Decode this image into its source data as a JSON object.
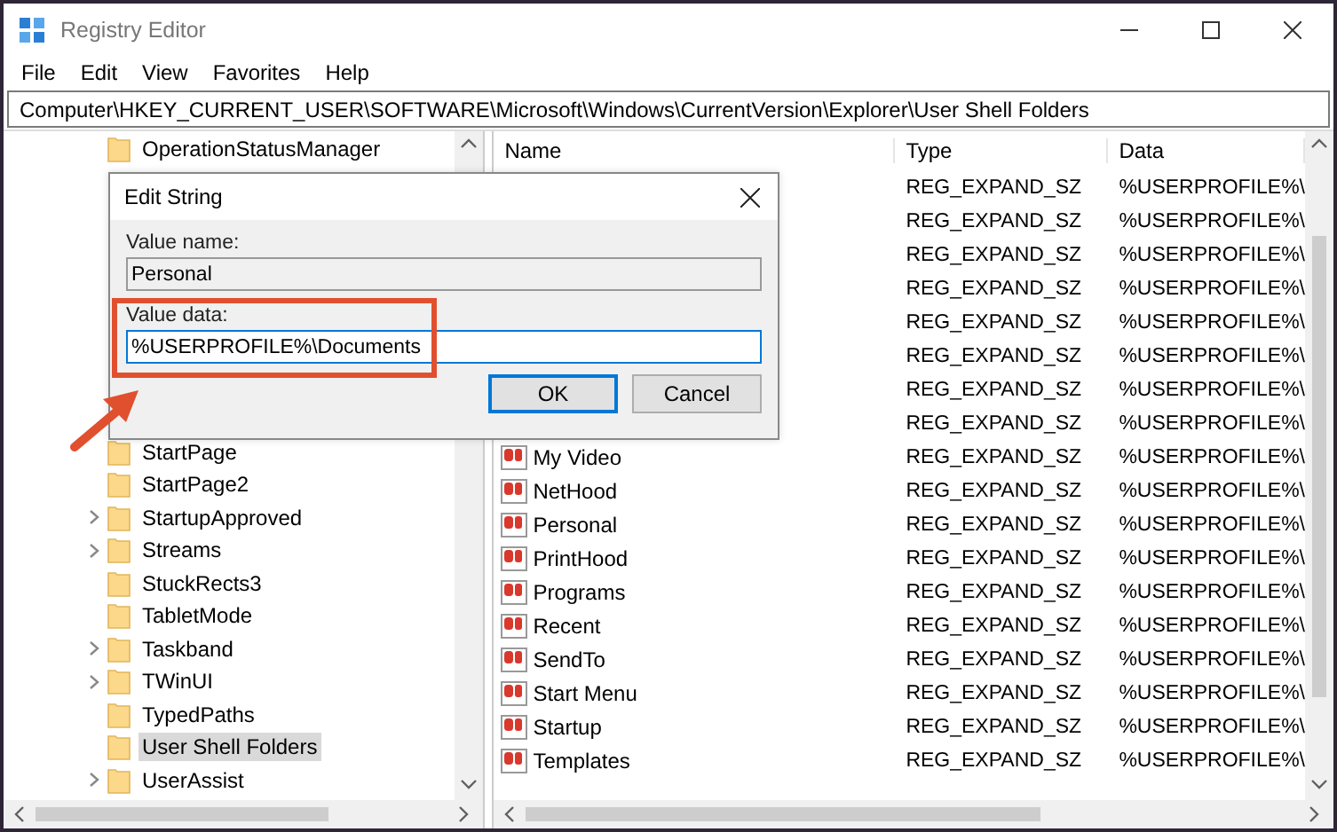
{
  "window": {
    "title": "Registry Editor"
  },
  "menu": [
    "File",
    "Edit",
    "View",
    "Favorites",
    "Help"
  ],
  "address": "Computer\\HKEY_CURRENT_USER\\SOFTWARE\\Microsoft\\Windows\\CurrentVersion\\Explorer\\User Shell Folders",
  "tree": {
    "top_items": [
      {
        "label": "OperationStatusManager",
        "expandable": false,
        "selected": false
      }
    ],
    "items": [
      {
        "label": "StartPage",
        "expandable": false,
        "selected": false
      },
      {
        "label": "StartPage2",
        "expandable": false,
        "selected": false
      },
      {
        "label": "StartupApproved",
        "expandable": true,
        "selected": false
      },
      {
        "label": "Streams",
        "expandable": true,
        "selected": false
      },
      {
        "label": "StuckRects3",
        "expandable": false,
        "selected": false
      },
      {
        "label": "TabletMode",
        "expandable": false,
        "selected": false
      },
      {
        "label": "Taskband",
        "expandable": true,
        "selected": false
      },
      {
        "label": "TWinUI",
        "expandable": true,
        "selected": false
      },
      {
        "label": "TypedPaths",
        "expandable": false,
        "selected": false
      },
      {
        "label": "User Shell Folders",
        "expandable": false,
        "selected": true
      },
      {
        "label": "UserAssist",
        "expandable": true,
        "selected": false
      }
    ]
  },
  "values": {
    "columns": [
      "Name",
      "Type",
      "Data"
    ],
    "rows": [
      {
        "type": "REG_EXPAND_SZ",
        "data": "%USERPROFILE%\\"
      },
      {
        "type": "REG_EXPAND_SZ",
        "data": "%USERPROFILE%\\"
      },
      {
        "type": "REG_EXPAND_SZ",
        "data": "%USERPROFILE%\\"
      },
      {
        "type": "REG_EXPAND_SZ",
        "data": "%USERPROFILE%\\"
      },
      {
        "type": "REG_EXPAND_SZ",
        "data": "%USERPROFILE%\\"
      },
      {
        "type": "REG_EXPAND_SZ",
        "data": "%USERPROFILE%\\"
      },
      {
        "type": "REG_EXPAND_SZ",
        "data": "%USERPROFILE%\\"
      },
      {
        "type": "REG_EXPAND_SZ",
        "data": "%USERPROFILE%\\"
      },
      {
        "name": "My Video",
        "type": "REG_EXPAND_SZ",
        "data": "%USERPROFILE%\\"
      },
      {
        "name": "NetHood",
        "type": "REG_EXPAND_SZ",
        "data": "%USERPROFILE%\\"
      },
      {
        "name": "Personal",
        "type": "REG_EXPAND_SZ",
        "data": "%USERPROFILE%\\"
      },
      {
        "name": "PrintHood",
        "type": "REG_EXPAND_SZ",
        "data": "%USERPROFILE%\\"
      },
      {
        "name": "Programs",
        "type": "REG_EXPAND_SZ",
        "data": "%USERPROFILE%\\"
      },
      {
        "name": "Recent",
        "type": "REG_EXPAND_SZ",
        "data": "%USERPROFILE%\\"
      },
      {
        "name": "SendTo",
        "type": "REG_EXPAND_SZ",
        "data": "%USERPROFILE%\\"
      },
      {
        "name": "Start Menu",
        "type": "REG_EXPAND_SZ",
        "data": "%USERPROFILE%\\"
      },
      {
        "name": "Startup",
        "type": "REG_EXPAND_SZ",
        "data": "%USERPROFILE%\\"
      },
      {
        "name": "Templates",
        "type": "REG_EXPAND_SZ",
        "data": "%USERPROFILE%\\"
      }
    ]
  },
  "dialog": {
    "title": "Edit String",
    "name_label": "Value name:",
    "name_value": "Personal",
    "data_label": "Value data:",
    "data_value": "%USERPROFILE%\\Documents",
    "buttons": [
      {
        "label": "OK",
        "default": true
      },
      {
        "label": "Cancel",
        "default": false
      }
    ]
  }
}
